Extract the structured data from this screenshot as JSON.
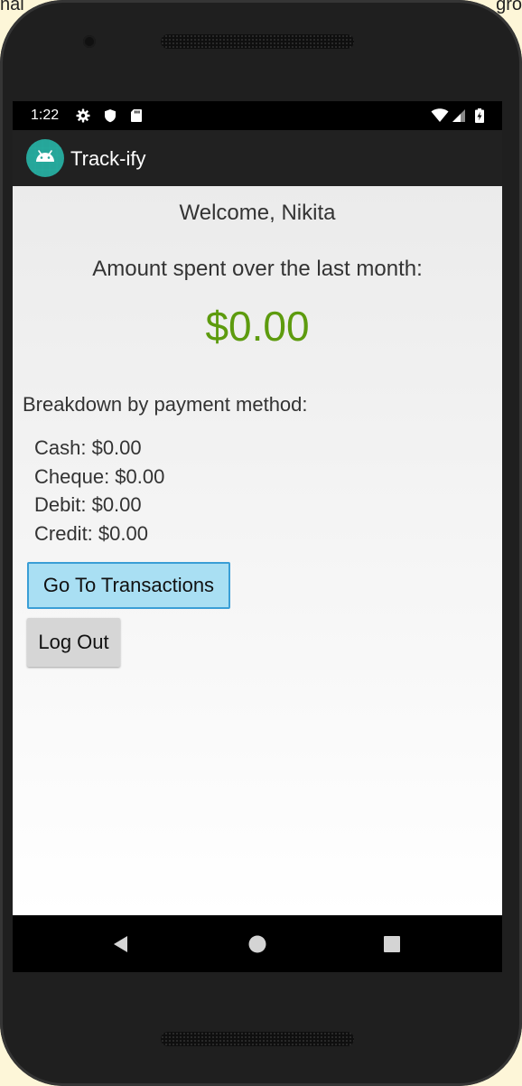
{
  "background": {
    "left_text": "nal",
    "right_text": "gro"
  },
  "status_bar": {
    "time": "1:22",
    "icons": [
      "gear-icon",
      "shield-icon",
      "sd-card-icon"
    ],
    "right_icons": [
      "wifi-icon",
      "signal-icon",
      "battery-icon"
    ]
  },
  "app_bar": {
    "title": "Track-ify",
    "logo_icon": "android-icon",
    "color": "#212121",
    "logo_color": "#26a69a"
  },
  "main": {
    "welcome": "Welcome, Nikita",
    "spent_label": "Amount spent over the last month:",
    "total": "$0.00",
    "total_color": "#5d9b0e",
    "breakdown_label": "Breakdown by payment method:",
    "breakdown": [
      {
        "label": "Cash: $0.00"
      },
      {
        "label": "Cheque: $0.00"
      },
      {
        "label": "Debit: $0.00"
      },
      {
        "label": "Credit: $0.00"
      }
    ]
  },
  "buttons": {
    "transactions_label": "Go To Transactions",
    "transactions_color": "#a9dff3",
    "logout_label": "Log Out"
  },
  "nav_bar": {
    "icons": [
      "back-icon",
      "home-icon",
      "recents-icon"
    ]
  }
}
